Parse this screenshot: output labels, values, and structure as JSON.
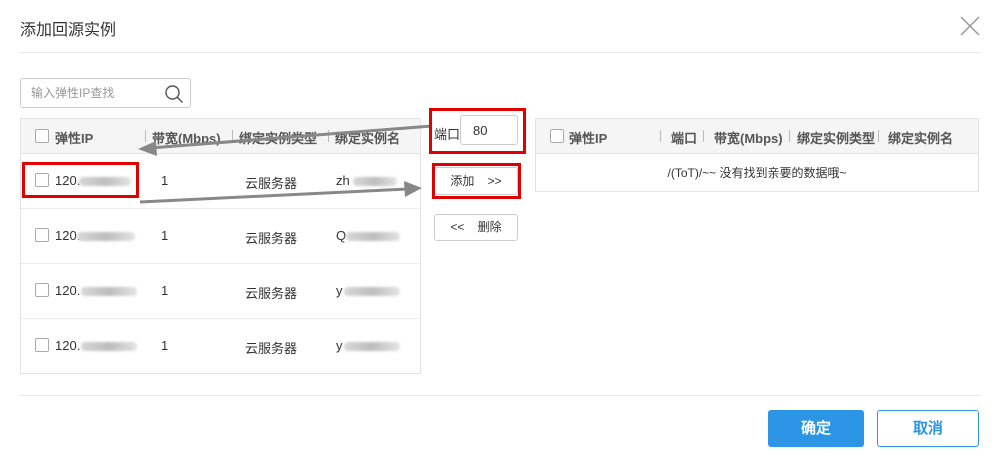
{
  "dialog": {
    "title": "添加回源实例",
    "close_icon": "close-icon"
  },
  "search": {
    "placeholder": "输入弹性IP查找",
    "icon": "search-icon"
  },
  "left_table": {
    "headers": [
      "弹性IP",
      "带宽(Mbps)",
      "绑定实例类型",
      "绑定实例名"
    ],
    "rows": [
      {
        "ip": "120.",
        "bandwidth": "1",
        "type": "云服务器",
        "name": "zh"
      },
      {
        "ip": "120.",
        "bandwidth": "1",
        "type": "云服务器",
        "name": "Q"
      },
      {
        "ip": "120.",
        "bandwidth": "1",
        "type": "云服务器",
        "name": "y"
      },
      {
        "ip": "120.",
        "bandwidth": "1",
        "type": "云服务器",
        "name": "y"
      }
    ]
  },
  "port": {
    "label": "端口:",
    "value": "80"
  },
  "actions": {
    "add_label": "添加    >>",
    "delete_label": "<<    删除"
  },
  "right_table": {
    "headers": [
      "弹性IP",
      "端口",
      "带宽(Mbps)",
      "绑定实例类型",
      "绑定实例名"
    ],
    "empty_text": "/(ToT)/~~ 没有找到亲要的数据哦~"
  },
  "footer": {
    "ok_label": "确定",
    "cancel_label": "取消"
  },
  "colors": {
    "primary": "#2d95e6",
    "annotation_red": "#e00000",
    "annotation_arrow": "#888888"
  }
}
